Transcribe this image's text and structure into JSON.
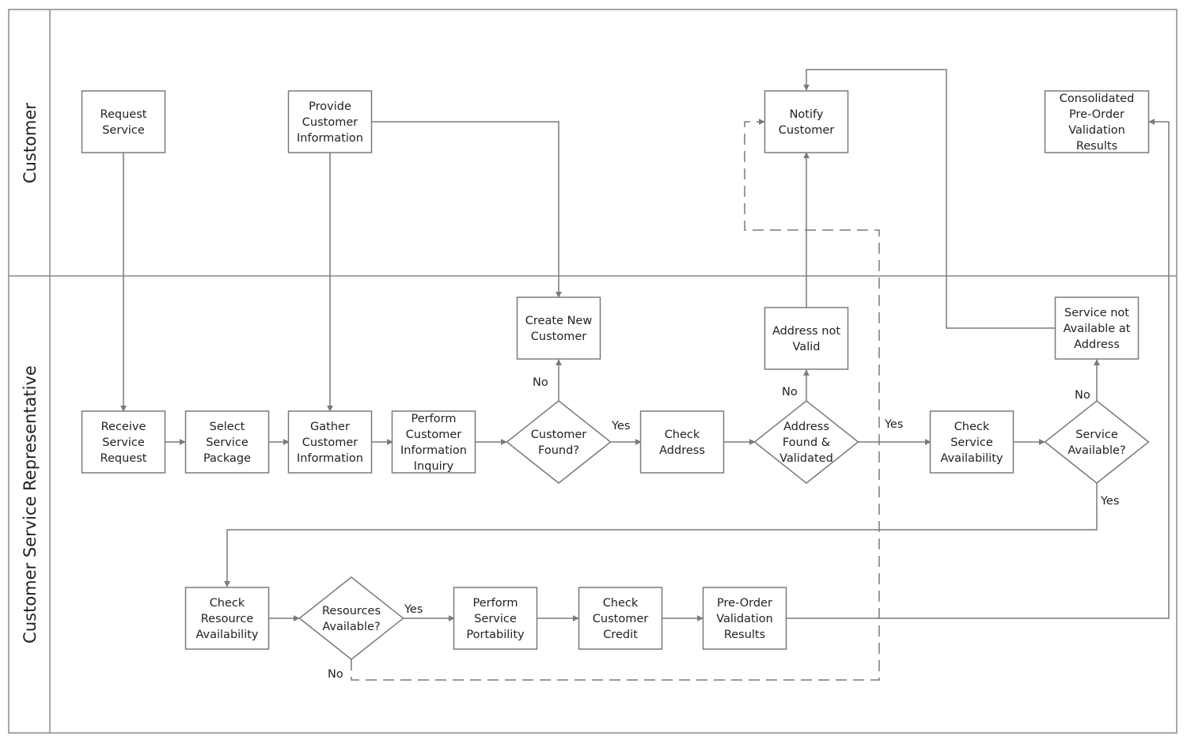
{
  "diagram": {
    "type": "cross-functional flowchart",
    "colors": {
      "stroke": "#7a7a7a",
      "text": "#222222",
      "background": "#ffffff"
    },
    "lanes": [
      {
        "id": "customer",
        "label": "Customer"
      },
      {
        "id": "csr",
        "label": "Customer Service Representative"
      }
    ],
    "nodes": [
      {
        "id": "request_service",
        "lane": "customer",
        "shape": "process",
        "lines": [
          "Request",
          "Service"
        ]
      },
      {
        "id": "provide_info",
        "lane": "customer",
        "shape": "process",
        "lines": [
          "Provide",
          "Customer",
          "Information"
        ]
      },
      {
        "id": "notify_customer",
        "lane": "customer",
        "shape": "process",
        "lines": [
          "Notify",
          "Customer"
        ]
      },
      {
        "id": "consolidated",
        "lane": "customer",
        "shape": "process",
        "lines": [
          "Consolidated",
          "Pre-Order",
          "Validation",
          "Results"
        ]
      },
      {
        "id": "receive_request",
        "lane": "csr",
        "shape": "process",
        "lines": [
          "Receive",
          "Service",
          "Request"
        ]
      },
      {
        "id": "select_package",
        "lane": "csr",
        "shape": "process",
        "lines": [
          "Select",
          "Service",
          "Package"
        ]
      },
      {
        "id": "gather_info",
        "lane": "csr",
        "shape": "process",
        "lines": [
          "Gather",
          "Customer",
          "Information"
        ]
      },
      {
        "id": "perform_inquiry",
        "lane": "csr",
        "shape": "process",
        "lines": [
          "Perform",
          "Customer",
          "Information",
          "Inquiry"
        ]
      },
      {
        "id": "customer_found",
        "lane": "csr",
        "shape": "decision",
        "lines": [
          "Customer",
          "Found?"
        ]
      },
      {
        "id": "create_customer",
        "lane": "csr",
        "shape": "process",
        "lines": [
          "Create New",
          "Customer"
        ]
      },
      {
        "id": "check_address",
        "lane": "csr",
        "shape": "process",
        "lines": [
          "Check",
          "Address"
        ]
      },
      {
        "id": "address_validated",
        "lane": "csr",
        "shape": "decision",
        "lines": [
          "Address",
          "Found &",
          "Validated"
        ]
      },
      {
        "id": "address_not_valid",
        "lane": "csr",
        "shape": "process",
        "lines": [
          "Address not",
          "Valid"
        ]
      },
      {
        "id": "check_service",
        "lane": "csr",
        "shape": "process",
        "lines": [
          "Check",
          "Service",
          "Availability"
        ]
      },
      {
        "id": "service_available",
        "lane": "csr",
        "shape": "decision",
        "lines": [
          "Service",
          "Available?"
        ]
      },
      {
        "id": "service_not_available",
        "lane": "csr",
        "shape": "process",
        "lines": [
          "Service not",
          "Available at",
          "Address"
        ]
      },
      {
        "id": "check_resource",
        "lane": "csr",
        "shape": "process",
        "lines": [
          "Check",
          "Resource",
          "Availability"
        ]
      },
      {
        "id": "resources_available",
        "lane": "csr",
        "shape": "decision",
        "lines": [
          "Resources",
          "Available?"
        ]
      },
      {
        "id": "perform_portability",
        "lane": "csr",
        "shape": "process",
        "lines": [
          "Perform",
          "Service",
          "Portability"
        ]
      },
      {
        "id": "check_credit",
        "lane": "csr",
        "shape": "process",
        "lines": [
          "Check",
          "Customer",
          "Credit"
        ]
      },
      {
        "id": "preorder_results",
        "lane": "csr",
        "shape": "process",
        "lines": [
          "Pre-Order",
          "Validation",
          "Results"
        ]
      }
    ],
    "edges": [
      {
        "from": "request_service",
        "to": "receive_request",
        "label": ""
      },
      {
        "from": "provide_info",
        "to": "gather_info",
        "label": ""
      },
      {
        "from": "provide_info",
        "to": "create_customer",
        "label": ""
      },
      {
        "from": "receive_request",
        "to": "select_package",
        "label": ""
      },
      {
        "from": "select_package",
        "to": "gather_info",
        "label": ""
      },
      {
        "from": "gather_info",
        "to": "perform_inquiry",
        "label": ""
      },
      {
        "from": "perform_inquiry",
        "to": "customer_found",
        "label": ""
      },
      {
        "from": "customer_found",
        "to": "create_customer",
        "label": "No"
      },
      {
        "from": "customer_found",
        "to": "check_address",
        "label": "Yes"
      },
      {
        "from": "check_address",
        "to": "address_validated",
        "label": ""
      },
      {
        "from": "address_validated",
        "to": "address_not_valid",
        "label": "No"
      },
      {
        "from": "address_not_valid",
        "to": "notify_customer",
        "label": ""
      },
      {
        "from": "address_validated",
        "to": "check_service",
        "label": "Yes"
      },
      {
        "from": "check_service",
        "to": "service_available",
        "label": ""
      },
      {
        "from": "service_available",
        "to": "service_not_available",
        "label": "No"
      },
      {
        "from": "service_not_available",
        "to": "notify_customer",
        "label": ""
      },
      {
        "from": "service_available",
        "to": "check_resource",
        "label": "Yes"
      },
      {
        "from": "check_resource",
        "to": "resources_available",
        "label": ""
      },
      {
        "from": "resources_available",
        "to": "perform_portability",
        "label": "Yes"
      },
      {
        "from": "resources_available",
        "to": "notify_customer",
        "label": "No",
        "style": "dashed"
      },
      {
        "from": "perform_portability",
        "to": "check_credit",
        "label": ""
      },
      {
        "from": "check_credit",
        "to": "preorder_results",
        "label": ""
      },
      {
        "from": "preorder_results",
        "to": "consolidated",
        "label": ""
      }
    ],
    "labels": {
      "yes": "Yes",
      "no": "No"
    }
  }
}
